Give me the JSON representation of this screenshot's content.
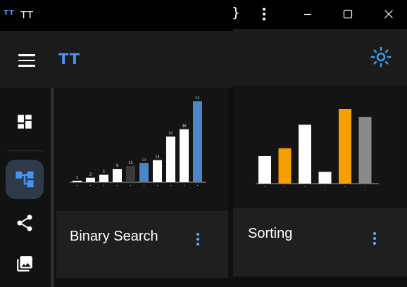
{
  "window": {
    "logo_text": "TT",
    "title": "TT"
  },
  "app_bar": {
    "title": "TT"
  },
  "rail": {
    "items": [
      "dashboard",
      "tree",
      "graph",
      "gallery"
    ],
    "active": "tree"
  },
  "cards": [
    {
      "title": "Binary Search",
      "thumbnail": {
        "values": [
          1,
          3,
          5,
          9,
          11,
          13,
          15,
          31,
          36,
          55
        ],
        "labels": [
          "1",
          "3",
          "5",
          "9",
          "11",
          "13",
          "15",
          "31",
          "36",
          "55"
        ],
        "colors": [
          "#ffffff",
          "#ffffff",
          "#ffffff",
          "#ffffff",
          "#3a3a3a",
          "#4a86c8",
          "#ffffff",
          "#ffffff",
          "#ffffff",
          "#4a86c8"
        ]
      }
    },
    {
      "title": "Sorting",
      "thumbnail": {
        "values": [
          7,
          9,
          15,
          3,
          19,
          17
        ],
        "colors": [
          "#ffffff",
          "#f5a000",
          "#ffffff",
          "#ffffff",
          "#f5a000",
          "#8a8a8a"
        ]
      }
    }
  ],
  "colors": {
    "accent_blue": "#4d8ef7",
    "sun": "#3f9df2",
    "orange": "#f5a000"
  },
  "icons": {
    "menu": "hamburger-icon",
    "dashboard": "dashboard-icon",
    "tree": "account-tree-icon",
    "graph": "share-icon",
    "gallery": "photo-library-icon",
    "more": "more-vert-icon",
    "theme": "light-mode-icon",
    "minimize": "minimize-icon",
    "maximize": "maximize-icon",
    "close": "close-icon"
  }
}
